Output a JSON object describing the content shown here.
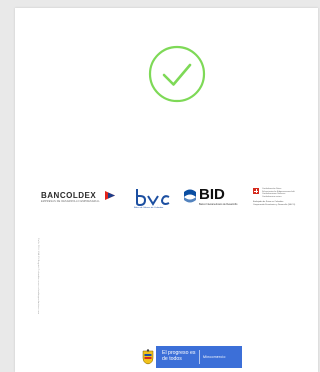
{
  "logos": {
    "bancoldex": {
      "name": "BANCOLDEX",
      "tagline": "EMPRESAS DE DESARROLLO EMPRESARIAL"
    },
    "bvc": {
      "name": "bvc",
      "subtitle": "Bolsa de Valores de Colombia"
    },
    "bid": {
      "name": "BID",
      "subtitle": "Banco Interamericano de Desarrollo"
    },
    "swiss": {
      "lines": [
        "Confederación Suiza",
        "Schweizerische Eidgenossenschaft",
        "Confederazione Svizzera",
        "Confederaziun svizra"
      ],
      "secretariat": [
        "Embajada de Suiza en Colombia",
        "Cooperación Económica y Desarrollo (SECO)"
      ]
    }
  },
  "side_text": "Calle 28 # 13A-15 Bogotá Colombia www.colombiaproductiva.com",
  "footer": {
    "slogan": "El progreso es de todos",
    "ministry": "Mincomercio"
  },
  "colors": {
    "check": "#7ed957",
    "bancoldex_red": "#e2231a",
    "bancoldex_blue": "#1b3f8b",
    "bvc_blue": "#1c4fa1",
    "bid_blue": "#0a4ea2",
    "banner_blue": "#3c6fd8"
  },
  "icons": {
    "success": "check-circle-icon"
  }
}
